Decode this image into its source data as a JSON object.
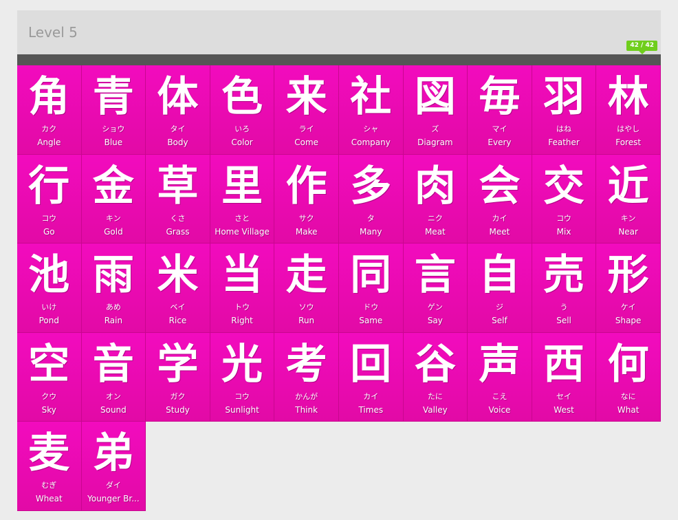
{
  "level": {
    "title": "Level 5"
  },
  "progress": {
    "label": "42 / 42",
    "completed": 42,
    "total": 42,
    "fraction": 1.0
  },
  "colors": {
    "card": "#f20bbe",
    "badge": "#6fce1c",
    "track": "#474747"
  },
  "items": [
    {
      "kanji": "角",
      "reading": "カク",
      "meaning": "Angle"
    },
    {
      "kanji": "青",
      "reading": "ショウ",
      "meaning": "Blue"
    },
    {
      "kanji": "体",
      "reading": "タイ",
      "meaning": "Body"
    },
    {
      "kanji": "色",
      "reading": "いろ",
      "meaning": "Color"
    },
    {
      "kanji": "来",
      "reading": "ライ",
      "meaning": "Come"
    },
    {
      "kanji": "社",
      "reading": "シャ",
      "meaning": "Company"
    },
    {
      "kanji": "図",
      "reading": "ズ",
      "meaning": "Diagram"
    },
    {
      "kanji": "毎",
      "reading": "マイ",
      "meaning": "Every"
    },
    {
      "kanji": "羽",
      "reading": "はね",
      "meaning": "Feather"
    },
    {
      "kanji": "林",
      "reading": "はやし",
      "meaning": "Forest"
    },
    {
      "kanji": "行",
      "reading": "コウ",
      "meaning": "Go"
    },
    {
      "kanji": "金",
      "reading": "キン",
      "meaning": "Gold"
    },
    {
      "kanji": "草",
      "reading": "くさ",
      "meaning": "Grass"
    },
    {
      "kanji": "里",
      "reading": "さと",
      "meaning": "Home Village"
    },
    {
      "kanji": "作",
      "reading": "サク",
      "meaning": "Make"
    },
    {
      "kanji": "多",
      "reading": "タ",
      "meaning": "Many"
    },
    {
      "kanji": "肉",
      "reading": "ニク",
      "meaning": "Meat"
    },
    {
      "kanji": "会",
      "reading": "カイ",
      "meaning": "Meet"
    },
    {
      "kanji": "交",
      "reading": "コウ",
      "meaning": "Mix"
    },
    {
      "kanji": "近",
      "reading": "キン",
      "meaning": "Near"
    },
    {
      "kanji": "池",
      "reading": "いけ",
      "meaning": "Pond"
    },
    {
      "kanji": "雨",
      "reading": "あめ",
      "meaning": "Rain"
    },
    {
      "kanji": "米",
      "reading": "ベイ",
      "meaning": "Rice"
    },
    {
      "kanji": "当",
      "reading": "トウ",
      "meaning": "Right"
    },
    {
      "kanji": "走",
      "reading": "ソウ",
      "meaning": "Run"
    },
    {
      "kanji": "同",
      "reading": "ドウ",
      "meaning": "Same"
    },
    {
      "kanji": "言",
      "reading": "ゲン",
      "meaning": "Say"
    },
    {
      "kanji": "自",
      "reading": "ジ",
      "meaning": "Self"
    },
    {
      "kanji": "売",
      "reading": "う",
      "meaning": "Sell"
    },
    {
      "kanji": "形",
      "reading": "ケイ",
      "meaning": "Shape"
    },
    {
      "kanji": "空",
      "reading": "クウ",
      "meaning": "Sky"
    },
    {
      "kanji": "音",
      "reading": "オン",
      "meaning": "Sound"
    },
    {
      "kanji": "学",
      "reading": "ガク",
      "meaning": "Study"
    },
    {
      "kanji": "光",
      "reading": "コウ",
      "meaning": "Sunlight"
    },
    {
      "kanji": "考",
      "reading": "かんが",
      "meaning": "Think"
    },
    {
      "kanji": "回",
      "reading": "カイ",
      "meaning": "Times"
    },
    {
      "kanji": "谷",
      "reading": "たに",
      "meaning": "Valley"
    },
    {
      "kanji": "声",
      "reading": "こえ",
      "meaning": "Voice"
    },
    {
      "kanji": "西",
      "reading": "セイ",
      "meaning": "West"
    },
    {
      "kanji": "何",
      "reading": "なに",
      "meaning": "What"
    },
    {
      "kanji": "麦",
      "reading": "むぎ",
      "meaning": "Wheat"
    },
    {
      "kanji": "弟",
      "reading": "ダイ",
      "meaning": "Younger Br..."
    }
  ]
}
